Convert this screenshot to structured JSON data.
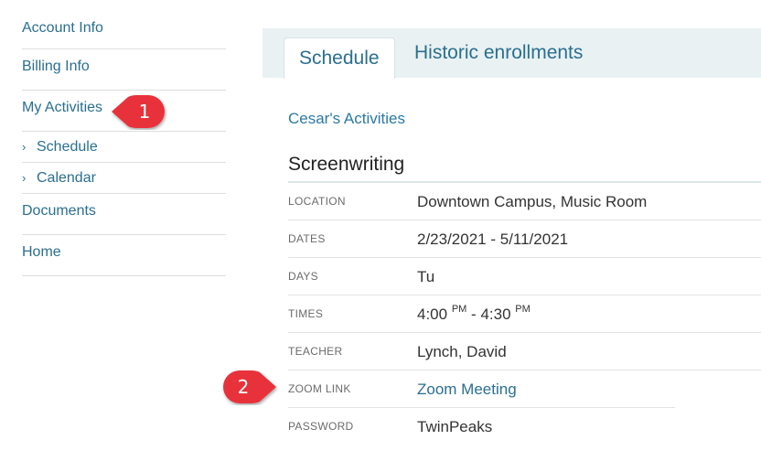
{
  "sidebar": {
    "items": [
      {
        "label": "Account Info"
      },
      {
        "label": "Billing Info"
      },
      {
        "label": "My Activities"
      },
      {
        "label": "Schedule"
      },
      {
        "label": "Calendar"
      },
      {
        "label": "Documents"
      },
      {
        "label": "Home"
      }
    ],
    "chevron": "›"
  },
  "tabs": [
    {
      "label": "Schedule"
    },
    {
      "label": "Historic enrollments"
    }
  ],
  "student_label": "Cesar's Activities",
  "activity": {
    "title": "Screenwriting",
    "details": [
      {
        "label": "LOCATION",
        "value": "Downtown Campus, Music Room"
      },
      {
        "label": "DATES",
        "value": "2/23/2021 - 5/11/2021"
      },
      {
        "label": "DAYS",
        "value": "Tu"
      },
      {
        "label": "TIMES",
        "start": "4:00",
        "start_ampm": "PM",
        "sep": " - ",
        "end": "4:30",
        "end_ampm": "PM"
      },
      {
        "label": "TEACHER",
        "value": "Lynch, David"
      },
      {
        "label": "ZOOM LINK",
        "value": "Zoom Meeting"
      },
      {
        "label": "PASSWORD",
        "value": "TwinPeaks"
      }
    ]
  },
  "callouts": [
    {
      "number": "1"
    },
    {
      "number": "2"
    }
  ],
  "colors": {
    "link": "#2a6f8f",
    "tab_bar": "#e9f1f3",
    "callout": "#e8333a"
  }
}
